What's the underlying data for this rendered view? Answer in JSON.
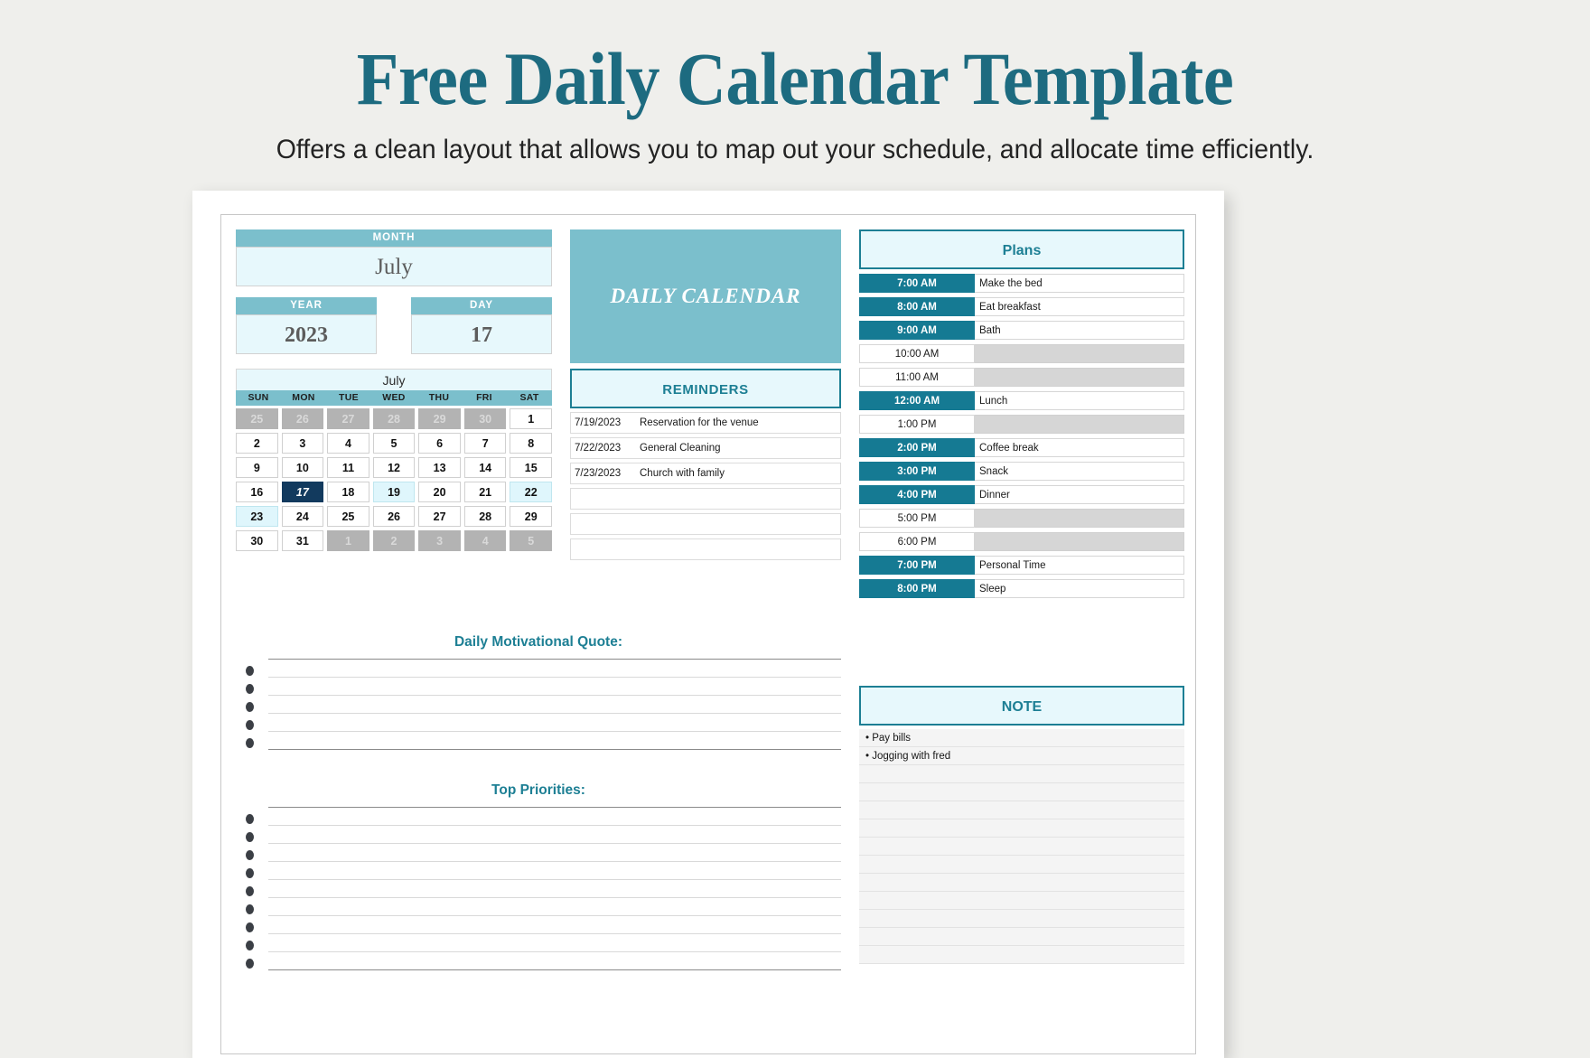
{
  "promo": {
    "title": "Free Daily Calendar Template",
    "subtitle": "Offers a clean layout that allows you to map out your schedule, and allocate time efficiently.",
    "title_color": "#1d6b80"
  },
  "colors": {
    "teal_light": "#7bbfcc",
    "teal_dark": "#157a93",
    "ice": "#e7f8fc",
    "navy": "#123a5e",
    "muted_gray": "#b3b3b3"
  },
  "date_panel": {
    "month_label": "MONTH",
    "month_value": "July",
    "year_label": "YEAR",
    "year_value": "2023",
    "day_label": "DAY",
    "day_value": "17"
  },
  "banner": {
    "text": "DAILY CALENDAR"
  },
  "mini_calendar": {
    "title": "July",
    "dow": [
      "SUN",
      "MON",
      "TUE",
      "WED",
      "THU",
      "FRI",
      "SAT"
    ],
    "weeks": [
      [
        {
          "d": "25",
          "s": "muted"
        },
        {
          "d": "26",
          "s": "muted"
        },
        {
          "d": "27",
          "s": "muted"
        },
        {
          "d": "28",
          "s": "muted"
        },
        {
          "d": "29",
          "s": "muted"
        },
        {
          "d": "30",
          "s": "muted"
        },
        {
          "d": "1",
          "s": ""
        }
      ],
      [
        {
          "d": "2",
          "s": ""
        },
        {
          "d": "3",
          "s": ""
        },
        {
          "d": "4",
          "s": ""
        },
        {
          "d": "5",
          "s": ""
        },
        {
          "d": "6",
          "s": ""
        },
        {
          "d": "7",
          "s": ""
        },
        {
          "d": "8",
          "s": ""
        }
      ],
      [
        {
          "d": "9",
          "s": ""
        },
        {
          "d": "10",
          "s": ""
        },
        {
          "d": "11",
          "s": ""
        },
        {
          "d": "12",
          "s": ""
        },
        {
          "d": "13",
          "s": ""
        },
        {
          "d": "14",
          "s": ""
        },
        {
          "d": "15",
          "s": ""
        }
      ],
      [
        {
          "d": "16",
          "s": ""
        },
        {
          "d": "17",
          "s": "today"
        },
        {
          "d": "18",
          "s": ""
        },
        {
          "d": "19",
          "s": "hl"
        },
        {
          "d": "20",
          "s": ""
        },
        {
          "d": "21",
          "s": ""
        },
        {
          "d": "22",
          "s": "hl"
        }
      ],
      [
        {
          "d": "23",
          "s": "hl"
        },
        {
          "d": "24",
          "s": ""
        },
        {
          "d": "25",
          "s": ""
        },
        {
          "d": "26",
          "s": ""
        },
        {
          "d": "27",
          "s": ""
        },
        {
          "d": "28",
          "s": ""
        },
        {
          "d": "29",
          "s": ""
        }
      ],
      [
        {
          "d": "30",
          "s": ""
        },
        {
          "d": "31",
          "s": ""
        },
        {
          "d": "1",
          "s": "muted"
        },
        {
          "d": "2",
          "s": "muted"
        },
        {
          "d": "3",
          "s": "muted"
        },
        {
          "d": "4",
          "s": "muted"
        },
        {
          "d": "5",
          "s": "muted"
        }
      ]
    ]
  },
  "reminders": {
    "heading": "REMINDERS",
    "rows": [
      {
        "date": "7/19/2023",
        "text": "Reservation for the venue"
      },
      {
        "date": "7/22/2023",
        "text": "General Cleaning"
      },
      {
        "date": "7/23/2023",
        "text": "Church with family"
      },
      {
        "date": "",
        "text": ""
      },
      {
        "date": "",
        "text": ""
      },
      {
        "date": "",
        "text": ""
      }
    ]
  },
  "quote_section": {
    "heading": "Daily Motivational Quote:",
    "lines": [
      "",
      "",
      "",
      "",
      ""
    ]
  },
  "priorities_section": {
    "heading": "Top Priorities:",
    "lines": [
      "",
      "",
      "",
      "",
      "",
      "",
      "",
      "",
      ""
    ]
  },
  "plans": {
    "heading": "Plans",
    "rows": [
      {
        "time": "7:00 AM",
        "text": "Make the bed",
        "filled": true
      },
      {
        "time": "8:00 AM",
        "text": "Eat breakfast",
        "filled": true
      },
      {
        "time": "9:00 AM",
        "text": "Bath",
        "filled": true
      },
      {
        "time": "10:00 AM",
        "text": "",
        "filled": false
      },
      {
        "time": "11:00 AM",
        "text": "",
        "filled": false
      },
      {
        "time": "12:00 AM",
        "text": "Lunch",
        "filled": true
      },
      {
        "time": "1:00 PM",
        "text": "",
        "filled": false
      },
      {
        "time": "2:00 PM",
        "text": "Coffee break",
        "filled": true
      },
      {
        "time": "3:00 PM",
        "text": "Snack",
        "filled": true
      },
      {
        "time": "4:00 PM",
        "text": "Dinner",
        "filled": true
      },
      {
        "time": "5:00 PM",
        "text": "",
        "filled": false
      },
      {
        "time": "6:00 PM",
        "text": "",
        "filled": false
      },
      {
        "time": "7:00 PM",
        "text": "Personal Time",
        "filled": true
      },
      {
        "time": "8:00 PM",
        "text": "Sleep",
        "filled": true
      }
    ]
  },
  "note": {
    "heading": "NOTE",
    "items": [
      "• Pay bills",
      "• Jogging with fred",
      "",
      "",
      "",
      "",
      "",
      "",
      "",
      "",
      "",
      "",
      ""
    ]
  }
}
